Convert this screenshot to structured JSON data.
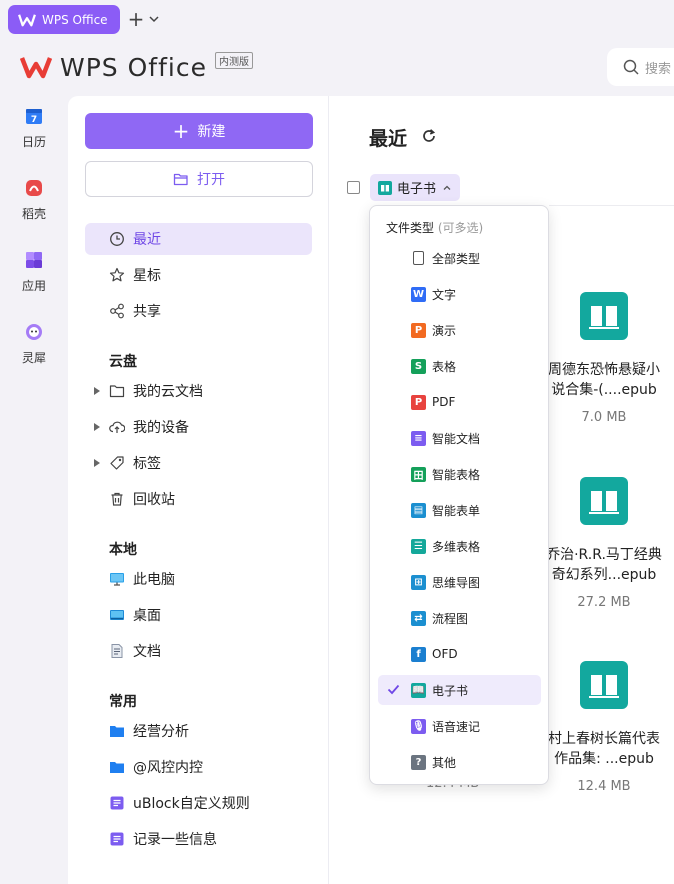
{
  "titlebar": {
    "tab_label": "WPS Office"
  },
  "brand": {
    "name": "WPS Office",
    "badge": "内测版"
  },
  "search": {
    "placeholder": "搜索"
  },
  "rail": [
    {
      "label": "日历",
      "icon": "calendar-icon"
    },
    {
      "label": "稻壳",
      "icon": "docer-icon"
    },
    {
      "label": "应用",
      "icon": "apps-icon"
    },
    {
      "label": "灵犀",
      "icon": "ai-assistant-icon"
    }
  ],
  "sidebar": {
    "new_label": "新建",
    "open_label": "打开",
    "nav": [
      {
        "label": "最近",
        "icon": "clock-icon",
        "active": true
      },
      {
        "label": "星标",
        "icon": "star-icon"
      },
      {
        "label": "共享",
        "icon": "share-icon"
      }
    ],
    "cloud_title": "云盘",
    "cloud": [
      {
        "label": "我的云文档",
        "icon": "folder-icon"
      },
      {
        "label": "我的设备",
        "icon": "cloud-device-icon"
      },
      {
        "label": "标签",
        "icon": "tag-icon"
      },
      {
        "label": "回收站",
        "icon": "trash-icon"
      }
    ],
    "local_title": "本地",
    "local": [
      {
        "label": "此电脑",
        "icon": "computer-icon"
      },
      {
        "label": "桌面",
        "icon": "desktop-icon"
      },
      {
        "label": "文档",
        "icon": "documents-icon"
      }
    ],
    "common_title": "常用",
    "common": [
      {
        "label": "经营分析",
        "icon": "blue-folder-icon"
      },
      {
        "label": "@风控内控",
        "icon": "blue-folder-icon"
      },
      {
        "label": "uBlock自定义规则",
        "icon": "smart-doc-icon"
      },
      {
        "label": "记录一些信息",
        "icon": "smart-doc-icon"
      }
    ]
  },
  "main": {
    "title": "最近",
    "filter_label": "电子书",
    "files": [
      {
        "name_line1": "周德东恐怖悬疑小",
        "name_line2": "说合集-(....epub",
        "size": "7.0 MB"
      },
      {
        "name_line1": "乔治·R.R.马丁经典",
        "name_line2": "奇幻系列...epub",
        "size": "27.2 MB"
      },
      {
        "name_line1": "村上春树长篇代表",
        "name_line2": "作品集: ...epub",
        "size": "12.4 MB"
      }
    ],
    "hidden_size": "12.4 MB"
  },
  "dropdown": {
    "header": "文件类型",
    "header_sub": "(可多选)",
    "items": [
      {
        "label": "全部类型",
        "icon": "all-types-icon",
        "color": "#ffffff",
        "glyph": ""
      },
      {
        "label": "文字",
        "icon": "word-icon",
        "color": "#2f6cf6",
        "glyph": "W"
      },
      {
        "label": "演示",
        "icon": "presentation-icon",
        "color": "#f26a21",
        "glyph": "P"
      },
      {
        "label": "表格",
        "icon": "spreadsheet-icon",
        "color": "#14a05a",
        "glyph": "S"
      },
      {
        "label": "PDF",
        "icon": "pdf-icon",
        "color": "#e8433e",
        "glyph": "P"
      },
      {
        "label": "智能文档",
        "icon": "smart-doc-icon",
        "color": "#7c5cf0",
        "glyph": "≡"
      },
      {
        "label": "智能表格",
        "icon": "smart-sheet-icon",
        "color": "#14a05a",
        "glyph": "田"
      },
      {
        "label": "智能表单",
        "icon": "smart-form-icon",
        "color": "#1b8fd0",
        "glyph": "▤"
      },
      {
        "label": "多维表格",
        "icon": "multidim-table-icon",
        "color": "#14a89a",
        "glyph": "☰"
      },
      {
        "label": "思维导图",
        "icon": "mindmap-icon",
        "color": "#1b8fd0",
        "glyph": "⊞"
      },
      {
        "label": "流程图",
        "icon": "flowchart-icon",
        "color": "#1b8fd0",
        "glyph": "⇄"
      },
      {
        "label": "OFD",
        "icon": "ofd-icon",
        "color": "#1b7fd0",
        "glyph": "f"
      },
      {
        "label": "电子书",
        "icon": "ebook-icon",
        "color": "#13a89e",
        "glyph": "📖",
        "selected": true
      },
      {
        "label": "语音速记",
        "icon": "voice-note-icon",
        "color": "#7c5cf0",
        "glyph": "🎙"
      },
      {
        "label": "其他",
        "icon": "other-icon",
        "color": "#6b7480",
        "glyph": "?"
      }
    ]
  },
  "colors": {
    "accent": "#8f68f4",
    "brand_red": "#e83d36",
    "ebook": "#13a89e"
  }
}
